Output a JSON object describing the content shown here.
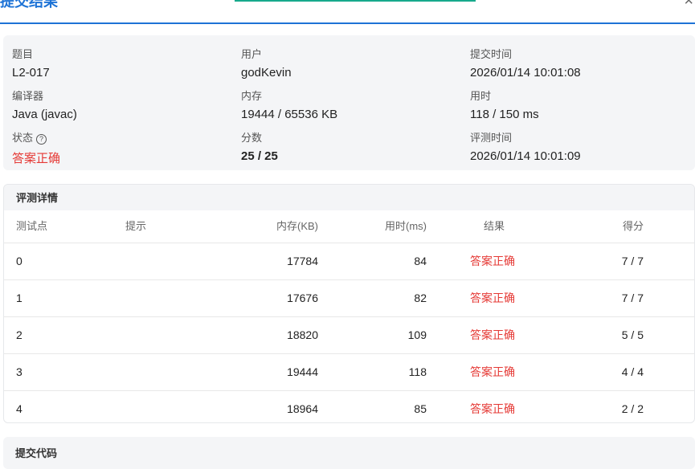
{
  "dialog": {
    "title": "提交结果",
    "close_icon": "×"
  },
  "summary": {
    "problem_label": "题目",
    "problem": "L2-017",
    "user_label": "用户",
    "user": "godKevin",
    "submit_time_label": "提交时间",
    "submit_time": "2026/01/14 10:01:08",
    "compiler_label": "编译器",
    "compiler": "Java (javac)",
    "memory_label": "内存",
    "memory": "19444 / 65536 KB",
    "time_label": "用时",
    "time": "118 / 150 ms",
    "status_label": "状态",
    "status": "答案正确",
    "status_color": "#e53935",
    "score_label": "分数",
    "score": "25 / 25",
    "judge_time_label": "评测时间",
    "judge_time": "2026/01/14 10:01:09"
  },
  "details": {
    "title": "评测详情",
    "headers": {
      "case": "测试点",
      "hint": "提示",
      "memory": "内存(KB)",
      "time": "用时(ms)",
      "result": "结果",
      "score": "得分"
    },
    "rows": [
      {
        "case": "0",
        "hint": "",
        "memory": "17784",
        "time": "84",
        "result": "答案正确",
        "score": "7 / 7"
      },
      {
        "case": "1",
        "hint": "",
        "memory": "17676",
        "time": "82",
        "result": "答案正确",
        "score": "7 / 7"
      },
      {
        "case": "2",
        "hint": "",
        "memory": "18820",
        "time": "109",
        "result": "答案正确",
        "score": "5 / 5"
      },
      {
        "case": "3",
        "hint": "",
        "memory": "19444",
        "time": "118",
        "result": "答案正确",
        "score": "4 / 4"
      },
      {
        "case": "4",
        "hint": "",
        "memory": "18964",
        "time": "85",
        "result": "答案正确",
        "score": "2 / 2"
      }
    ]
  },
  "code": {
    "title": "提交代码"
  },
  "colors": {
    "accent": "#1e73d6",
    "tab_indicator": "#17a98c",
    "success": "#e53935"
  }
}
